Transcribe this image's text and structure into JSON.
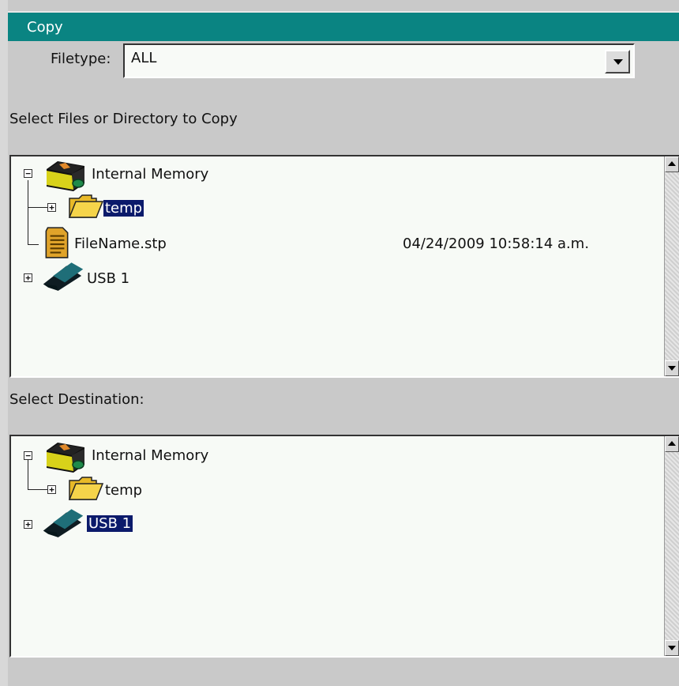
{
  "window": {
    "title": "Copy"
  },
  "filetype": {
    "label": "Filetype:",
    "value": "ALL"
  },
  "source": {
    "label": "Select Files or Directory to Copy",
    "tree": {
      "internal": {
        "label": "Internal Memory",
        "icon": "memory-card-icon"
      },
      "temp": {
        "label": "temp",
        "icon": "folder-icon",
        "selected": true
      },
      "file": {
        "label": "FileName.stp",
        "date": "04/24/2009 10:58:14 a.m.",
        "icon": "document-icon"
      },
      "usb": {
        "label": "USB 1",
        "icon": "usb-drive-icon"
      }
    }
  },
  "destination": {
    "label": "Select Destination:",
    "tree": {
      "internal": {
        "label": "Internal Memory",
        "icon": "memory-card-icon"
      },
      "temp": {
        "label": "temp",
        "icon": "folder-icon"
      },
      "usb": {
        "label": "USB 1",
        "icon": "usb-drive-icon",
        "selected": true
      }
    }
  },
  "colors": {
    "title_bar": "#0a8482",
    "selection": "#0b1a6b",
    "panel": "#f7faf6",
    "background": "#c9c9c9"
  }
}
